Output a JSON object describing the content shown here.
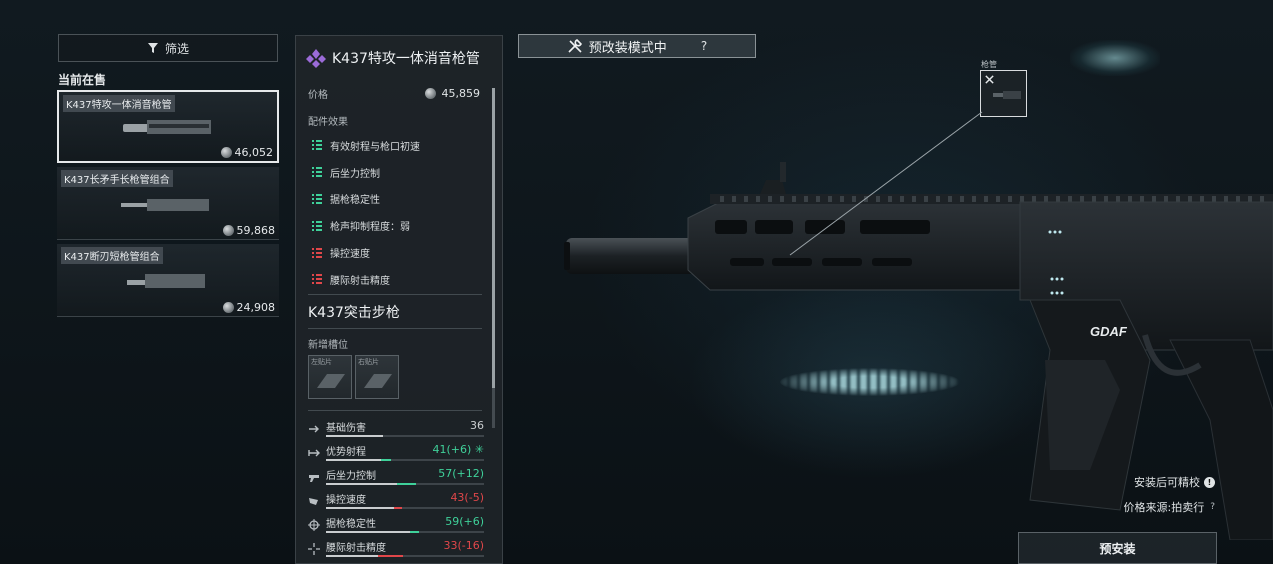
{
  "filter": {
    "label": "筛选"
  },
  "section_title": "当前在售",
  "listings": [
    {
      "name": "K437特攻一体消音枪管",
      "price": "46,052",
      "selected": true
    },
    {
      "name": "K437长矛手长枪管组合",
      "price": "59,868",
      "selected": false
    },
    {
      "name": "K437断刃短枪管组合",
      "price": "24,908",
      "selected": false
    }
  ],
  "detail": {
    "title": "K437特攻一体消音枪管",
    "price_label": "价格",
    "price_value": "45,859",
    "effects_label": "配件效果",
    "effects": [
      {
        "label": "有效射程与枪口初速",
        "tone": "positive"
      },
      {
        "label": "后坐力控制",
        "tone": "positive"
      },
      {
        "label": "据枪稳定性",
        "tone": "positive"
      },
      {
        "label": "枪声抑制程度：弱",
        "tone": "positive"
      },
      {
        "label": "操控速度",
        "tone": "negative"
      },
      {
        "label": "腰际射击精度",
        "tone": "negative"
      }
    ],
    "weapon_name": "K437突击步枪",
    "slots_label": "新增槽位",
    "slots": [
      {
        "label": "左贴片"
      },
      {
        "label": "右贴片"
      }
    ],
    "stats": [
      {
        "label": "基础伤害",
        "value": "36",
        "base": 0.36,
        "delta": 0,
        "tone": "neutral",
        "icon": "damage-icon"
      },
      {
        "label": "优势射程",
        "value": "41(+6) ✳",
        "base": 0.35,
        "delta": 0.06,
        "tone": "positive",
        "icon": "range-icon"
      },
      {
        "label": "后坐力控制",
        "value": "57(+12)",
        "base": 0.45,
        "delta": 0.12,
        "tone": "positive",
        "icon": "recoil-icon"
      },
      {
        "label": "操控速度",
        "value": "43(-5)",
        "base": 0.43,
        "delta": 0.05,
        "tone": "negative",
        "icon": "handling-icon"
      },
      {
        "label": "据枪稳定性",
        "value": "59(+6)",
        "base": 0.53,
        "delta": 0.06,
        "tone": "positive",
        "icon": "stability-icon"
      },
      {
        "label": "腰际射击精度",
        "value": "33(-16)",
        "base": 0.33,
        "delta": 0.16,
        "tone": "negative",
        "icon": "hipfire-icon"
      }
    ]
  },
  "banner": {
    "label": "预改装模式中",
    "help": "?"
  },
  "attachment_tag": {
    "label": "枪管"
  },
  "gun_markings": {
    "brand": "GDAF"
  },
  "footer": {
    "calibrate": "安装后可精校",
    "calibrate_icon": "!",
    "price_source": "价格来源:拍卖行",
    "price_source_help": "?",
    "preinstall": "预安装"
  },
  "colors": {
    "positive": "#3fd19a",
    "negative": "#e0474a",
    "neutral": "#c9cdcf",
    "accent_purple": "#9b6bd8"
  }
}
